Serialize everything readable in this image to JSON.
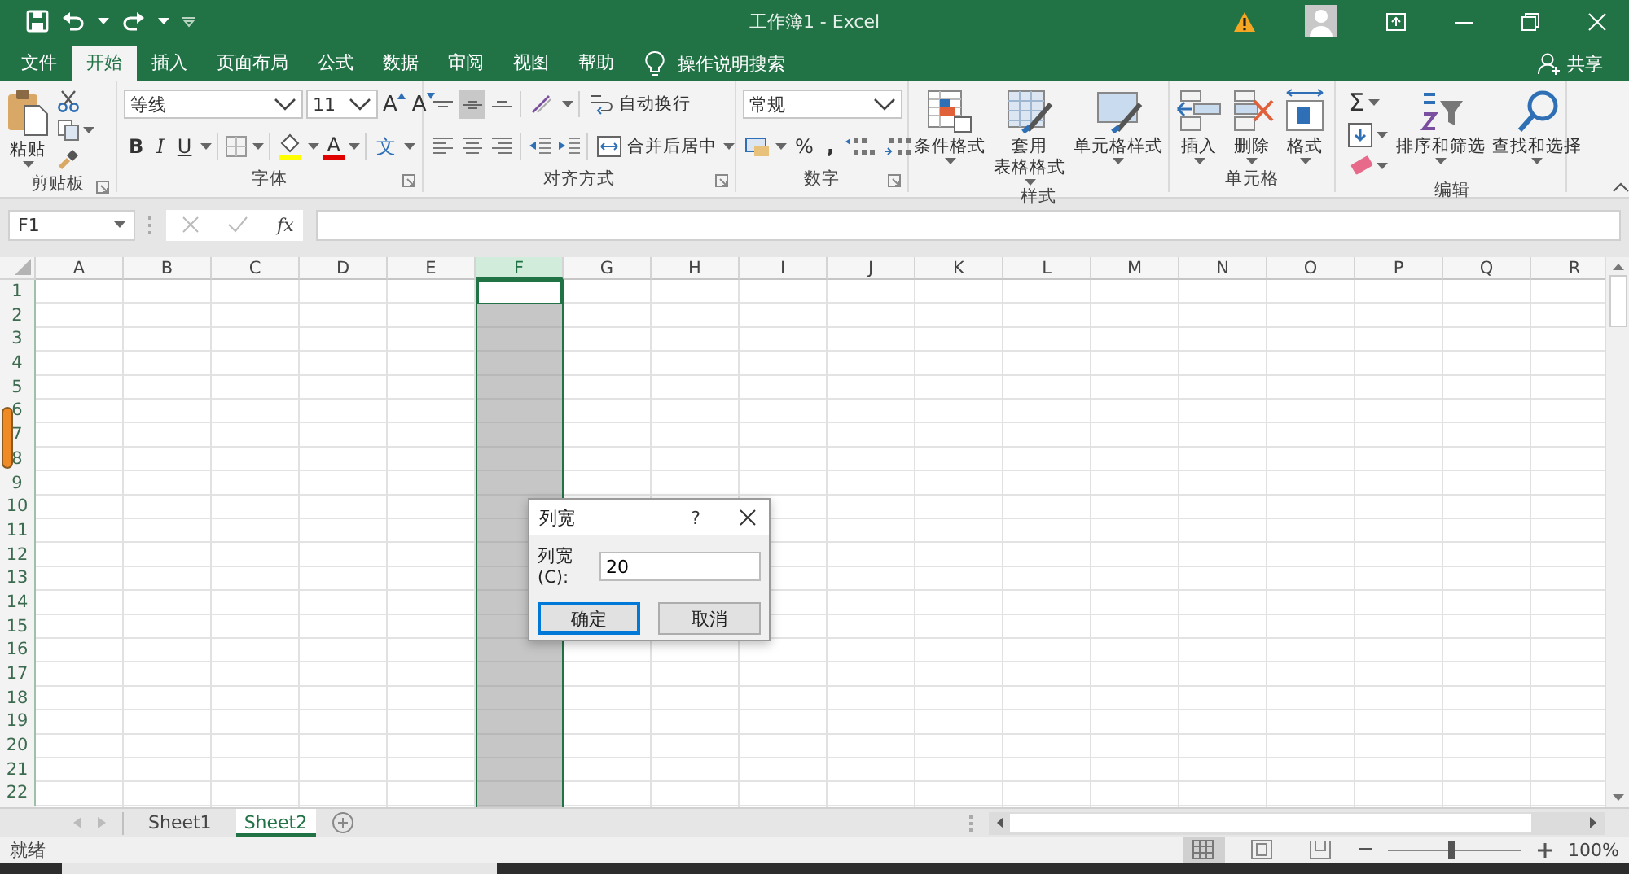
{
  "window": {
    "title": "工作簿1 - Excel"
  },
  "ribbon_tabs": [
    {
      "label": "文件",
      "selected": false
    },
    {
      "label": "开始",
      "selected": true
    },
    {
      "label": "插入",
      "selected": false
    },
    {
      "label": "页面布局",
      "selected": false
    },
    {
      "label": "公式",
      "selected": false
    },
    {
      "label": "数据",
      "selected": false
    },
    {
      "label": "审阅",
      "selected": false
    },
    {
      "label": "视图",
      "selected": false
    },
    {
      "label": "帮助",
      "selected": false
    }
  ],
  "tell_me": "操作说明搜索",
  "share": "共享",
  "ribbon_groups": [
    {
      "kind": "clipboard",
      "label": "剪贴板",
      "paste": "粘贴"
    },
    {
      "kind": "font",
      "label": "字体",
      "font_name": "等线",
      "font_size": "11",
      "grow_font": "A",
      "shrink_font": "A",
      "bold": "B",
      "italic": "I",
      "underline": "U",
      "font_color": "A",
      "phonetic": "文"
    },
    {
      "kind": "alignment",
      "label": "对齐方式",
      "vertical_align": [
        {
          "selected": false
        },
        {
          "selected": true
        },
        {
          "selected": false
        }
      ],
      "wrap_text": "自动换行",
      "merge_center": "合并后居中"
    },
    {
      "kind": "number",
      "label": "数字",
      "format": "常规",
      "percent": "%",
      "comma": ","
    },
    {
      "kind": "styles",
      "label": "样式",
      "commands": [
        {
          "kind": "conditional_format",
          "lines": [
            "条件格式"
          ]
        },
        {
          "kind": "table_format",
          "lines": [
            "套用",
            "表格格式"
          ]
        },
        {
          "kind": "cell_styles",
          "lines": [
            "单元格样式"
          ]
        }
      ]
    },
    {
      "kind": "cells",
      "label": "单元格",
      "commands": [
        {
          "kind": "insert",
          "lines": [
            "插入"
          ]
        },
        {
          "kind": "delete",
          "lines": [
            "删除"
          ]
        },
        {
          "kind": "format",
          "lines": [
            "格式"
          ]
        }
      ]
    },
    {
      "kind": "editing",
      "label": "编辑",
      "sum": "Σ",
      "commands": [
        {
          "kind": "sort_filter",
          "lines": [
            "排序和筛选"
          ]
        },
        {
          "kind": "find_select",
          "lines": [
            "查找和选择"
          ]
        }
      ]
    }
  ],
  "formula_bar": {
    "name_box": "F1",
    "function_button": "fx"
  },
  "columns": [
    {
      "label": "A",
      "selected": false
    },
    {
      "label": "B",
      "selected": false
    },
    {
      "label": "C",
      "selected": false
    },
    {
      "label": "D",
      "selected": false
    },
    {
      "label": "E",
      "selected": false
    },
    {
      "label": "F",
      "selected": true
    },
    {
      "label": "G",
      "selected": false
    },
    {
      "label": "H",
      "selected": false
    },
    {
      "label": "I",
      "selected": false
    },
    {
      "label": "J",
      "selected": false
    },
    {
      "label": "K",
      "selected": false
    },
    {
      "label": "L",
      "selected": false
    },
    {
      "label": "M",
      "selected": false
    },
    {
      "label": "N",
      "selected": false
    },
    {
      "label": "O",
      "selected": false
    },
    {
      "label": "P",
      "selected": false
    },
    {
      "label": "Q",
      "selected": false
    },
    {
      "label": "R",
      "selected": false
    }
  ],
  "rows": [
    "1",
    "2",
    "3",
    "4",
    "5",
    "6",
    "7",
    "8",
    "9",
    "10",
    "11",
    "12",
    "13",
    "14",
    "15",
    "16",
    "17",
    "18",
    "19",
    "20",
    "21",
    "22"
  ],
  "dialog": {
    "title": "列宽",
    "help": "?",
    "field_label": "列宽(C):",
    "value": "20",
    "buttons": [
      {
        "label": "确定",
        "default": true
      },
      {
        "label": "取消",
        "default": false
      }
    ]
  },
  "sheets": [
    {
      "label": "Sheet1",
      "selected": false
    },
    {
      "label": "Sheet2",
      "selected": true
    }
  ],
  "status_bar": {
    "text": "就绪",
    "views": [
      {
        "selected": true
      },
      {
        "selected": false
      },
      {
        "selected": false
      }
    ],
    "zoom": {
      "level": 0.48,
      "reading": "100%"
    }
  }
}
